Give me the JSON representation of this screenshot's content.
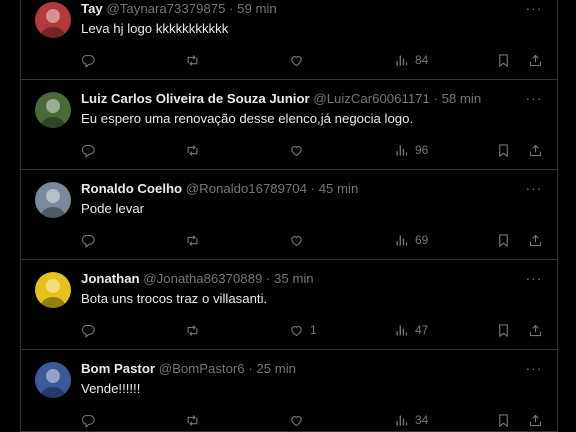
{
  "tweets": [
    {
      "name": "Tay",
      "handle": "@Taynara73379875",
      "time": "59 min",
      "text": "Leva hj logo kkkkkkkkkkk",
      "replies": "",
      "retweets": "",
      "likes": "",
      "views": "84",
      "avatar_color": "#b33a3a"
    },
    {
      "name": "Luiz Carlos Oliveira de Souza Junior",
      "handle": "@LuizCar60061171",
      "time": "58 min",
      "text": "Eu espero uma renovação desse elenco,já negocia logo.",
      "replies": "",
      "retweets": "",
      "likes": "",
      "views": "96",
      "avatar_color": "#4a6a3a"
    },
    {
      "name": "Ronaldo Coelho",
      "handle": "@Ronaldo16789704",
      "time": "45 min",
      "text": "Pode levar",
      "replies": "",
      "retweets": "",
      "likes": "",
      "views": "69",
      "avatar_color": "#7a8a9a"
    },
    {
      "name": "Jonathan",
      "handle": "@Jonatha86370889",
      "time": "35 min",
      "text": "Bota uns trocos traz o villasanti.",
      "replies": "",
      "retweets": "",
      "likes": "1",
      "views": "47",
      "avatar_color": "#e6c21a"
    },
    {
      "name": "Bom Pastor",
      "handle": "@BomPastor6",
      "time": "25 min",
      "text": "Vende!!!!!!",
      "replies": "",
      "retweets": "",
      "likes": "",
      "views": "34",
      "avatar_color": "#3a5a9a"
    }
  ],
  "separator": "·",
  "more_glyph": "···",
  "icons": {
    "reply": "reply-icon",
    "retweet": "retweet-icon",
    "like": "heart-icon",
    "views": "views-icon",
    "bookmark": "bookmark-icon",
    "share": "share-icon"
  },
  "colors": {
    "background": "#000000",
    "text": "#e7e9ea",
    "muted": "#71767b",
    "border": "#2f3336"
  }
}
